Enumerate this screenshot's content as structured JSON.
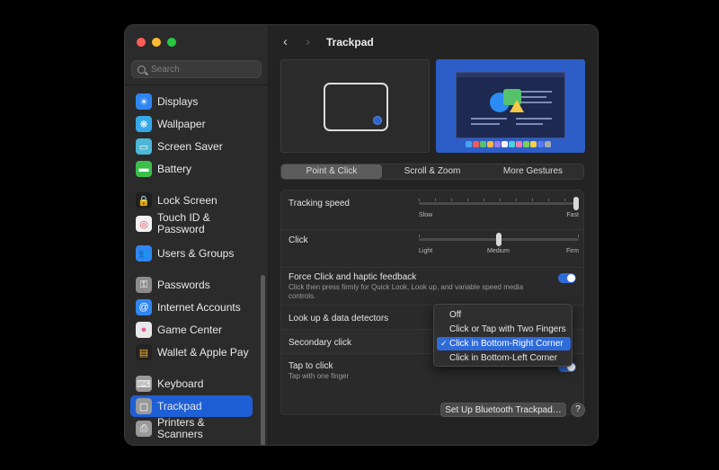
{
  "window": {
    "title": "Trackpad"
  },
  "search": {
    "placeholder": "Search"
  },
  "sidebar": {
    "items": [
      {
        "label": "Displays",
        "icon": "sun-icon",
        "color": "#2f86f0",
        "glyph": "☀"
      },
      {
        "label": "Wallpaper",
        "icon": "snowflake-icon",
        "color": "#35a8e8",
        "glyph": "❋"
      },
      {
        "label": "Screen Saver",
        "icon": "screen-saver-icon",
        "color": "#4cb8d8",
        "glyph": "▭"
      },
      {
        "label": "Battery",
        "icon": "battery-icon",
        "color": "#3bbf4a",
        "glyph": "▬"
      },
      {
        "label": "Lock Screen",
        "icon": "lock-icon",
        "color": "#1f1f1f",
        "glyph": "🔒"
      },
      {
        "label": "Touch ID & Password",
        "icon": "fingerprint-icon",
        "color": "#f1f1f1",
        "glyph": "◎"
      },
      {
        "label": "Users & Groups",
        "icon": "users-icon",
        "color": "#2f86f0",
        "glyph": "👥"
      },
      {
        "label": "Passwords",
        "icon": "key-icon",
        "color": "#8c8c8c",
        "glyph": "⚿"
      },
      {
        "label": "Internet Accounts",
        "icon": "at-icon",
        "color": "#2f86f0",
        "glyph": "@"
      },
      {
        "label": "Game Center",
        "icon": "game-center-icon",
        "color": "#e8e8e8",
        "glyph": "●"
      },
      {
        "label": "Wallet & Apple Pay",
        "icon": "wallet-icon",
        "color": "#222222",
        "glyph": "▤"
      },
      {
        "label": "Keyboard",
        "icon": "keyboard-icon",
        "color": "#9a9a9a",
        "glyph": "⌨"
      },
      {
        "label": "Trackpad",
        "icon": "trackpad-icon",
        "color": "#9a9a9a",
        "glyph": "▢"
      },
      {
        "label": "Printers & Scanners",
        "icon": "printer-icon",
        "color": "#9a9a9a",
        "glyph": "⎙"
      }
    ]
  },
  "tabs": [
    "Point & Click",
    "Scroll & Zoom",
    "More Gestures"
  ],
  "settings": {
    "tracking_speed": {
      "label": "Tracking speed",
      "min_label": "Slow",
      "max_label": "Fast",
      "value": 1.0
    },
    "click": {
      "label": "Click",
      "labels": [
        "Light",
        "Medium",
        "Firm"
      ],
      "value": 0.5
    },
    "force_click": {
      "label": "Force Click and haptic feedback",
      "description": "Click then press firmly for Quick Look, Look up, and variable speed media controls.",
      "enabled": true
    },
    "lookup": {
      "label": "Look up & data detectors"
    },
    "secondary_click": {
      "label": "Secondary click"
    },
    "tap_to_click": {
      "label": "Tap to click",
      "description": "Tap with one finger",
      "enabled": true
    }
  },
  "secondary_click_menu": {
    "options": [
      "Off",
      "Click or Tap with Two Fingers",
      "Click in Bottom-Right Corner",
      "Click in Bottom-Left Corner"
    ],
    "selected": "Click in Bottom-Right Corner"
  },
  "buttons": {
    "setup_bluetooth": "Set Up Bluetooth Trackpad…",
    "help": "?"
  }
}
